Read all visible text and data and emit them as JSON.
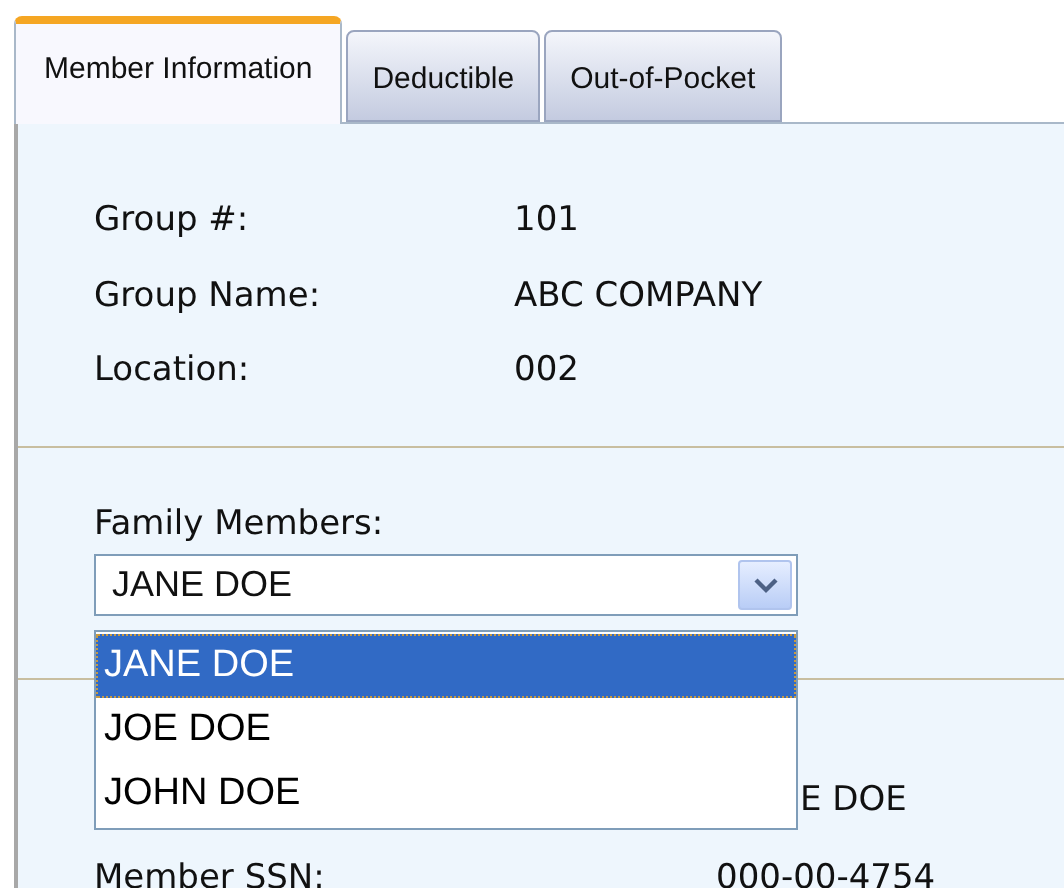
{
  "tabs": [
    {
      "label": "Member Information",
      "selected": true
    },
    {
      "label": "Deductible",
      "selected": false
    },
    {
      "label": "Out-of-Pocket",
      "selected": false
    }
  ],
  "group_info": [
    {
      "label": "Group #:",
      "value": "101"
    },
    {
      "label": "Group Name:",
      "value": "ABC COMPANY"
    },
    {
      "label": "Location:",
      "value": "002"
    }
  ],
  "family_members": {
    "label": "Family Members:",
    "value": "JANE DOE",
    "expanded": true,
    "options": [
      {
        "label": "JANE DOE",
        "selected": true
      },
      {
        "label": "JOE DOE",
        "selected": false
      },
      {
        "label": "JOHN DOE",
        "selected": false
      }
    ]
  },
  "member_info": [
    {
      "value": "E DOE"
    },
    {
      "label": "Member SSN:",
      "value": "000-00-4754"
    }
  ]
}
